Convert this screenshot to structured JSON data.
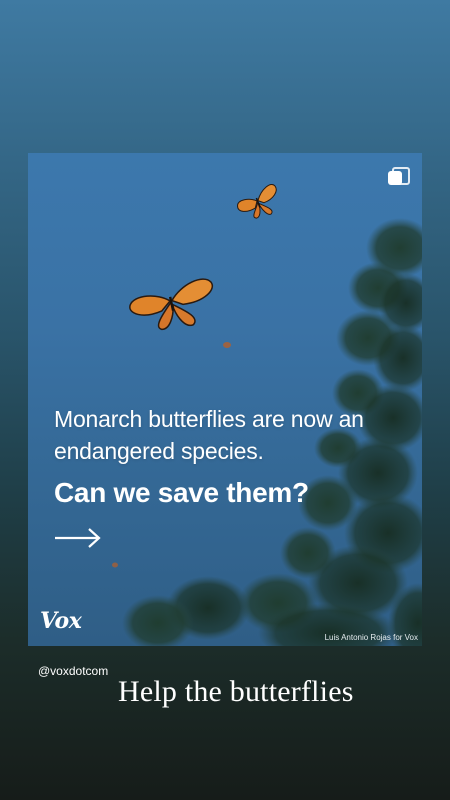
{
  "post": {
    "headline": "Monarch butterflies are now an endangered species.",
    "question": "Can we save them?",
    "logo": "Vox",
    "photo_credit": "Luis Antonio Rojas for Vox",
    "arrow_icon": "arrow-right-icon",
    "multi_icon": "carousel-icon"
  },
  "story": {
    "handle": "@voxdotcom",
    "caption": "Help the butterflies"
  },
  "colors": {
    "sky": "#3a72a5",
    "tree": "#1e3a2c",
    "monarch_orange": "#e0842a",
    "text": "#ffffff"
  }
}
